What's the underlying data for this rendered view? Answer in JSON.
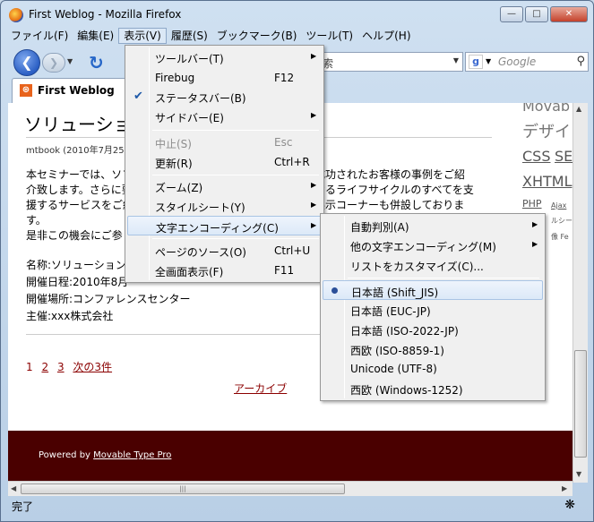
{
  "window": {
    "title": "First Weblog - Mozilla Firefox"
  },
  "menubar": [
    "ファイル(F)",
    "編集(E)",
    "表示(V)",
    "履歴(S)",
    "ブックマーク(B)",
    "ツール(T)",
    "ヘルプ(H)"
  ],
  "nav": {
    "url_fragment": "索",
    "search_placeholder": "Google"
  },
  "tab": {
    "label": "First Weblog"
  },
  "page": {
    "post_title": "ソリューショ",
    "post_meta": "mtbook (2010年7月25E",
    "body_lines": [
      "本セミナーでは、ソフ",
      "介致します。さらに要",
      "援するサービスをご紹",
      "す。",
      "是非この機会にご参"
    ],
    "body_right": [
      "、成功されたお客様の事例をご紹",
      "おけるライフサイクルのすべてを支",
      "く展示コーナーも併設しておりま"
    ],
    "details": [
      "名称:ソリューション",
      "開催日程:2010年8月",
      "開催場所:コンファレンスセンター",
      "主催:xxx株式会社"
    ],
    "pager": {
      "p1": "1",
      "p2": "2",
      "p3": "3",
      "next": "次の3件"
    },
    "archive": "アーカイブ",
    "footer_prefix": "Powered by ",
    "footer_link": "Movable Type Pro",
    "side_tags": [
      "Movab",
      "デザイ",
      "CSS",
      "SE",
      "XHTML",
      "PHP",
      "Ajax",
      "ルシー",
      "像",
      "Fe"
    ]
  },
  "status": {
    "text": "完了"
  },
  "view_menu": {
    "items": [
      {
        "label": "ツールバー(T)",
        "shortcut": "",
        "submenu": true
      },
      {
        "label": "Firebug",
        "shortcut": "F12",
        "submenu": false
      },
      {
        "label": "ステータスバー(B)",
        "shortcut": "",
        "submenu": false,
        "checked": true
      },
      {
        "label": "サイドバー(E)",
        "shortcut": "",
        "submenu": true
      },
      {
        "label": "中止(S)",
        "shortcut": "Esc",
        "submenu": false,
        "disabled": true
      },
      {
        "label": "更新(R)",
        "shortcut": "Ctrl+R",
        "submenu": false
      },
      {
        "label": "ズーム(Z)",
        "shortcut": "",
        "submenu": true
      },
      {
        "label": "スタイルシート(Y)",
        "shortcut": "",
        "submenu": true
      },
      {
        "label": "文字エンコーディング(C)",
        "shortcut": "",
        "submenu": true,
        "highlighted": true
      },
      {
        "label": "ページのソース(O)",
        "shortcut": "Ctrl+U",
        "submenu": false
      },
      {
        "label": "全画面表示(F)",
        "shortcut": "F11",
        "submenu": false
      }
    ]
  },
  "encoding_menu": {
    "items": [
      {
        "label": "自動判別(A)",
        "submenu": true
      },
      {
        "label": "他の文字エンコーディング(M)",
        "submenu": true
      },
      {
        "label": "リストをカスタマイズ(C)...",
        "submenu": false
      },
      {
        "label": "日本語 (Shift_JIS)",
        "selected": true
      },
      {
        "label": "日本語 (EUC-JP)"
      },
      {
        "label": "日本語 (ISO-2022-JP)"
      },
      {
        "label": "西欧 (ISO-8859-1)"
      },
      {
        "label": "Unicode (UTF-8)"
      },
      {
        "label": "西欧 (Windows-1252)"
      }
    ]
  }
}
